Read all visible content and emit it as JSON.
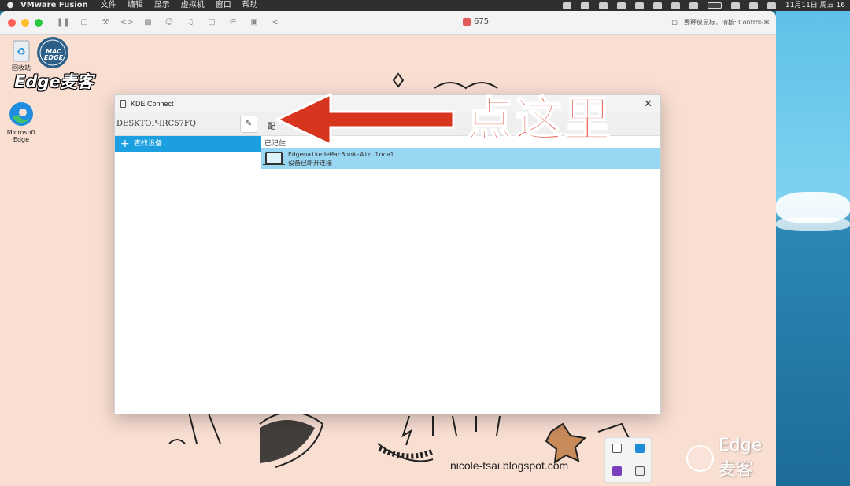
{
  "menubar": {
    "app_name": "VMware Fusion",
    "items": [
      "文件",
      "编辑",
      "显示",
      "虚拟机",
      "窗口",
      "帮助"
    ],
    "clock": "11月11日 周五 16"
  },
  "vm": {
    "title_count": "675",
    "hint": "要释放鼠标，请按: Control-⌘"
  },
  "desktop": {
    "brand": "Edge麦客",
    "logo_text": "MAC EDGE",
    "recycle_label": "回收站",
    "edge_label_1": "Microsoft",
    "edge_label_2": "Edge"
  },
  "kde": {
    "title": "KDE Connect",
    "device_name": "DESKTOP-IRC57FQ",
    "config_label": "配",
    "find_devices": "查找设备...",
    "remembered": "已记住",
    "remote_device": "EdgemaikedeMacBook-Air.local",
    "remote_status": "设备已断开连接"
  },
  "annotation": {
    "callout": "点这里",
    "color": "#d8351f"
  },
  "footer": {
    "url": "nicole-tsai.blogspot.com",
    "wechat_brand": "Edge麦客"
  },
  "colors": {
    "accent_blue": "#1b9fe0",
    "selected_row": "#99d6f1",
    "desktop_bg": "#f9ded2"
  }
}
